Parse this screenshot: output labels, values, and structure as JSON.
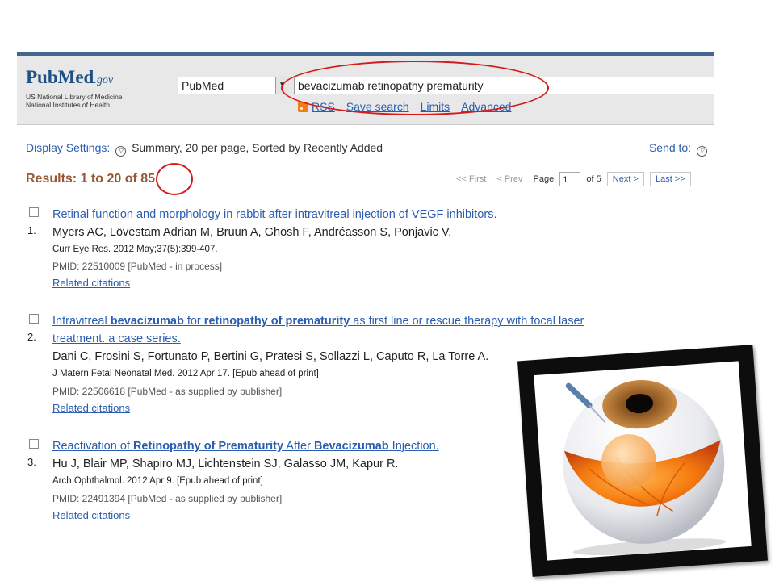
{
  "header": {
    "logo": {
      "pub": "Pub",
      "med": "Med",
      "gov": ".gov",
      "line1": "US National Library of Medicine",
      "line2": "National Institutes of Health"
    },
    "database_select": "PubMed",
    "search_query": "bevacizumab retinopathy prematurity",
    "links": {
      "rss": "RSS",
      "save_search": "Save search",
      "limits": "Limits",
      "advanced": "Advanced"
    }
  },
  "display": {
    "settings_label": "Display Settings:",
    "settings_value": "Summary, 20 per page, Sorted by Recently Added",
    "send_to": "Send to:"
  },
  "results": {
    "prefix": "Results: 1 to 20 of ",
    "total": "85"
  },
  "pager": {
    "first": "<< First",
    "prev": "< Prev",
    "page_label": "Page",
    "page_value": "1",
    "of_label": "of 5",
    "next": "Next >",
    "last": "Last >>"
  },
  "items": [
    {
      "number": "1.",
      "title": "Retinal function and morphology in rabbit after intravitreal injection of VEGF inhibitors.",
      "authors": "Myers AC, Lövestam Adrian M, Bruun A, Ghosh F, Andréasson S, Ponjavic V.",
      "journal": "Curr Eye Res. 2012 May;37(5):399-407.",
      "pmid": "PMID: 22510009 [PubMed - in process]",
      "related": "Related citations"
    },
    {
      "number": "2.",
      "title_parts": [
        "Intravitreal ",
        "bevacizumab",
        " for ",
        "retinopathy of prematurity",
        " as first line or rescue therapy with focal laser",
        "treatment. a case series."
      ],
      "authors": "Dani C, Frosini S, Fortunato P, Bertini G, Pratesi S, Sollazzi L, Caputo R, La Torre A.",
      "journal": "J Matern Fetal Neonatal Med. 2012 Apr 17. [Epub ahead of print]",
      "pmid": "PMID: 22506618 [PubMed - as supplied by publisher]",
      "related": "Related citations"
    },
    {
      "number": "3.",
      "title_parts": [
        "Reactivation of ",
        "Retinopathy of Prematurity",
        " After ",
        "Bevacizumab",
        " Injection."
      ],
      "authors": "Hu J, Blair MP, Shapiro MJ, Lichtenstein SJ, Galasso JM, Kapur R.",
      "journal": "Arch Ophthalmol. 2012 Apr 9. [Epub ahead of print]",
      "pmid": "PMID: 22491394 [PubMed - as supplied by publisher]",
      "related": "Related citations"
    }
  ],
  "colors": {
    "link": "#2a5db0",
    "results": "#985735",
    "annotation": "#d61a1a",
    "logo": "#1e4f85"
  },
  "icons": [
    "rss-icon",
    "dropdown-arrow-icon",
    "checkbox",
    "eye-illustration"
  ]
}
